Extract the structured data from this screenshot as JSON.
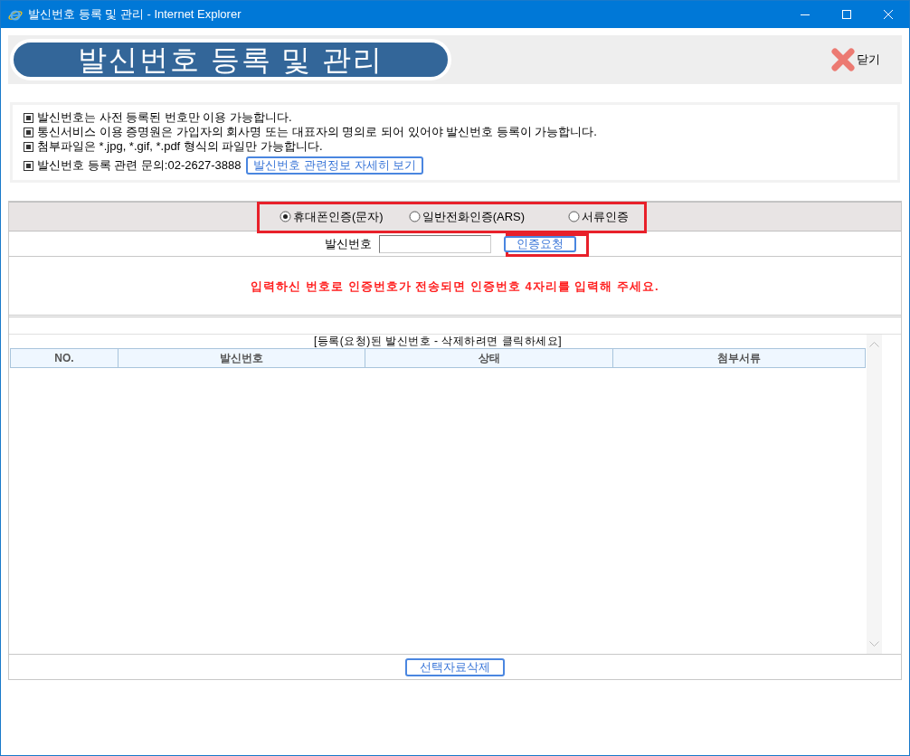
{
  "window": {
    "title": "발신번호 등록 및 관리 - Internet Explorer"
  },
  "header": {
    "title": "발신번호 등록 및 관리",
    "close_label": "닫기"
  },
  "notices": [
    {
      "text": "발신번호는 사전 등록된 번호만 이용 가능합니다."
    },
    {
      "text": "통신서비스 이용 증명원은 가입자의 회사명 또는 대표자의 명의로 되어 있어야 발신번호 등록이 가능합니다."
    },
    {
      "text": "첨부파일은 *.jpg, *.gif, *.pdf 형식의 파일만 가능합니다."
    },
    {
      "text": "발신번호 등록 관련 문의:02-2627-3888",
      "button": "발신번호 관련정보 자세히 보기"
    }
  ],
  "auth_methods": [
    {
      "label": "휴대폰인증(문자)",
      "selected": true
    },
    {
      "label": "일반전화인증(ARS)",
      "selected": false
    },
    {
      "label": "서류인증",
      "selected": false
    }
  ],
  "number_field": {
    "label": "발신번호"
  },
  "request_button": "인증요청",
  "message": "입력하신 번호로 인증번호가 전송되면 인증번호 4자리를 입력해 주세요.",
  "list": {
    "caption": "[등록(요청)된 발신번호 - 삭제하려면 클릭하세요]",
    "columns": [
      "NO.",
      "발신번호",
      "상태",
      "첨부서류"
    ]
  },
  "delete_button": "선택자료삭제"
}
